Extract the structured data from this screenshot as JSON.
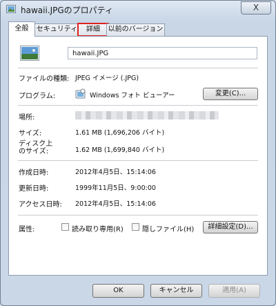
{
  "window": {
    "title": "hawaii.JPGのプロパティ",
    "close_symbol": "X"
  },
  "tabs": [
    "全般",
    "セキュリティ",
    "詳細",
    "以前のバージョン"
  ],
  "general": {
    "filename": "hawaii.JPG",
    "file_type_label": "ファイルの種類:",
    "file_type_value": "JPEG イメージ (.JPG)",
    "program_label": "プログラム:",
    "program_value": "Windows フォト ビューアー",
    "change_button": "変更(C)...",
    "location_label": "場所:",
    "size_label": "サイズ:",
    "size_value": "1.61 MB (1,696,206 バイト)",
    "disk_size_label_line1": "ディスク上",
    "disk_size_label_line2": "のサイズ:",
    "disk_size_value": "1.62 MB (1,699,840 バイト)",
    "created_label": "作成日時:",
    "created_value": "2012年4月5日、15:14:06",
    "modified_label": "更新日時:",
    "modified_value": "1999年11月5日、9:00:00",
    "accessed_label": "アクセス日時:",
    "accessed_value": "2012年4月5日、15:14:06",
    "attributes_label": "属性:",
    "readonly_label": "読み取り専用(R)",
    "hidden_label": "隠しファイル(H)",
    "advanced_button": "詳細設定(D)..."
  },
  "footer": {
    "ok": "OK",
    "cancel": "キャンセル",
    "apply": "適用(A)"
  },
  "icons": [
    "image-file-icon",
    "photo-thumbnail-icon",
    "photo-viewer-icon",
    "close-icon"
  ],
  "colors": {
    "highlight_outline": "#e0211d",
    "titlebar": "#cfdbe9"
  }
}
